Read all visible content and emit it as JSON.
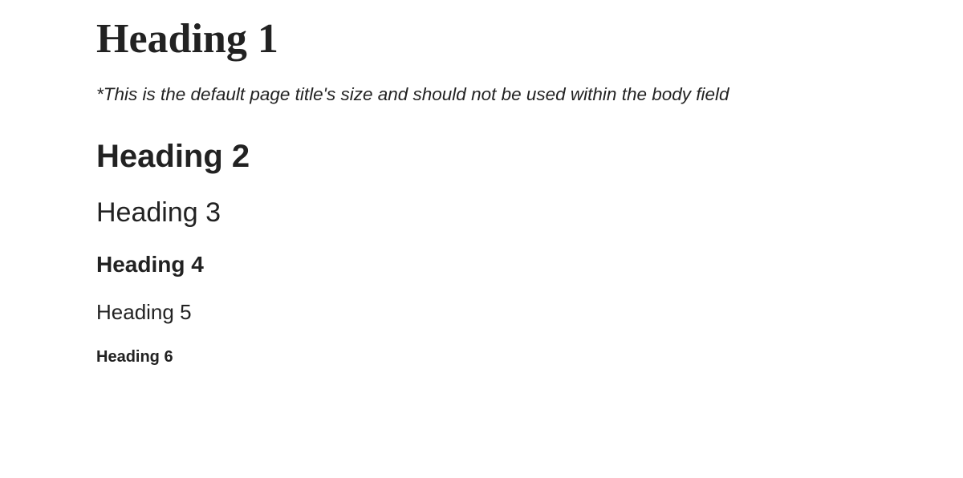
{
  "headings": {
    "h1": "Heading 1",
    "h2": "Heading 2",
    "h3": "Heading 3",
    "h4": "Heading 4",
    "h5": "Heading 5",
    "h6": "Heading 6"
  },
  "note": "*This is the default page title's size and should not be used within the body field"
}
